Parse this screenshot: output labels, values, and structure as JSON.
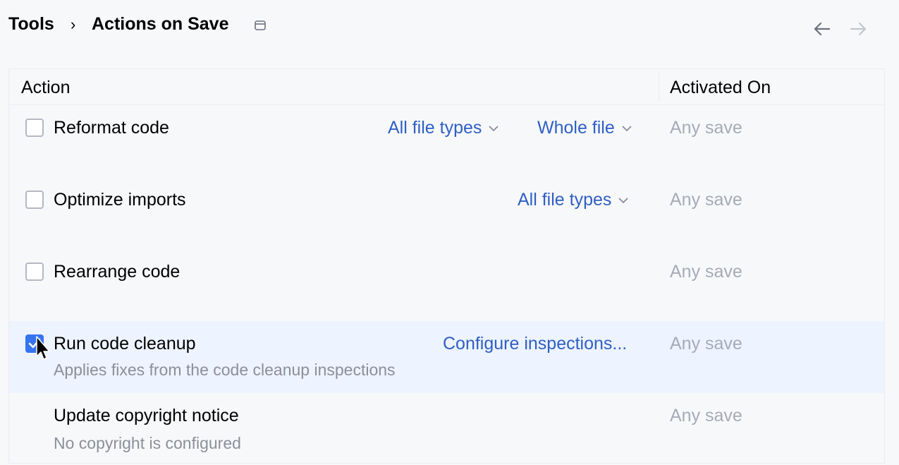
{
  "header": {
    "breadcrumb": [
      "Tools",
      "Actions on Save"
    ],
    "separator": "›",
    "icons": {
      "window": "window-icon",
      "back": "arrow-left-icon",
      "forward": "arrow-right-icon"
    }
  },
  "table": {
    "columns": [
      "Action",
      "Activated On"
    ],
    "rows": [
      {
        "title": "Reformat code",
        "checked": false,
        "links": [
          "All file types",
          "Whole file"
        ],
        "activated_on": "Any save"
      },
      {
        "title": "Optimize imports",
        "checked": false,
        "links": [
          "All file types"
        ],
        "activated_on": "Any save"
      },
      {
        "title": "Rearrange code",
        "checked": false,
        "activated_on": "Any save"
      },
      {
        "title": "Run code cleanup",
        "checked": true,
        "selected": true,
        "description": "Applies fixes from the code cleanup inspections",
        "link": "Configure inspections...",
        "activated_on": "Any save"
      },
      {
        "title": "Update copyright notice",
        "description": "No copyright is configured",
        "activated_on": "Any save"
      }
    ]
  },
  "colors": {
    "accent": "#3574f0",
    "link": "#2f5fc4",
    "muted": "#a6abb8",
    "selected_row": "#edf3ff",
    "background": "#f7f8fa"
  }
}
